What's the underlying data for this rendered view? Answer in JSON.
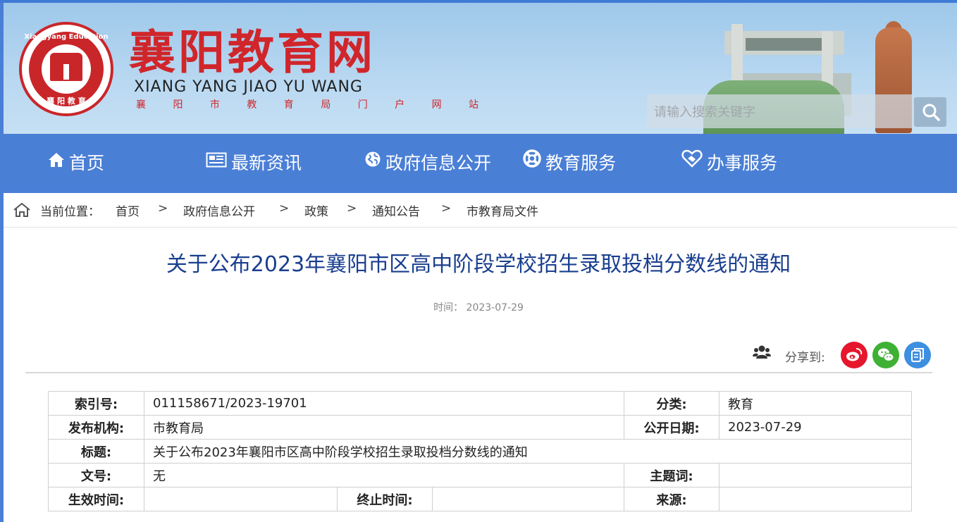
{
  "site": {
    "name_cn": "襄阳教育网",
    "name_en": "XIANG YANG JIAO YU WANG",
    "subtitle": "襄 阳 市 教 育 局 门 户 网 站",
    "emblem_top_text": "Xiangyang Education",
    "emblem_bottom_text": "襄 阳 教 育"
  },
  "search": {
    "placeholder": "请输入搜索关键字",
    "value": ""
  },
  "nav": [
    {
      "label": "首页",
      "icon": "home-icon"
    },
    {
      "label": "最新资讯",
      "icon": "newspaper-icon"
    },
    {
      "label": "政府信息公开",
      "icon": "globe-icon"
    },
    {
      "label": "教育服务",
      "icon": "lifebuoy-icon"
    },
    {
      "label": "办事服务",
      "icon": "handshake-heart-icon"
    }
  ],
  "breadcrumb": {
    "prefix": "当前位置：",
    "items": [
      "首页",
      "政府信息公开",
      "政策",
      "通知公告",
      "市教育局文件"
    ],
    "separator": ">"
  },
  "article": {
    "title": "关于公布2023年襄阳市区高中阶段学校招生录取投档分数线的通知",
    "time_label": "时间：",
    "time": "2023-07-29"
  },
  "share": {
    "label": "分享到:",
    "buttons": [
      {
        "name": "weibo",
        "color": "#e6162d"
      },
      {
        "name": "wechat",
        "color": "#3eb135"
      },
      {
        "name": "copy",
        "color": "#3d8fe0"
      }
    ]
  },
  "info_table": {
    "index_label": "索引号:",
    "index_value": "011158671/2023-19701",
    "category_label": "分类:",
    "category_value": "教育",
    "publisher_label": "发布机构:",
    "publisher_value": "市教育局",
    "pubdate_label": "公开日期:",
    "pubdate_value": "2023-07-29",
    "title_label": "标题:",
    "title_value": "关于公布2023年襄阳市区高中阶段学校招生录取投档分数线的通知",
    "docno_label": "文号:",
    "docno_value": "无",
    "keywords_label": "主题词:",
    "keywords_value": "",
    "effective_label": "生效时间:",
    "effective_value": "",
    "expiry_label": "终止时间:",
    "expiry_value": "",
    "source_label": "来源:",
    "source_value": ""
  },
  "colors": {
    "nav_bg": "#4a7fd6",
    "brand_red": "#d0262b",
    "title_blue": "#1a3f8f"
  }
}
